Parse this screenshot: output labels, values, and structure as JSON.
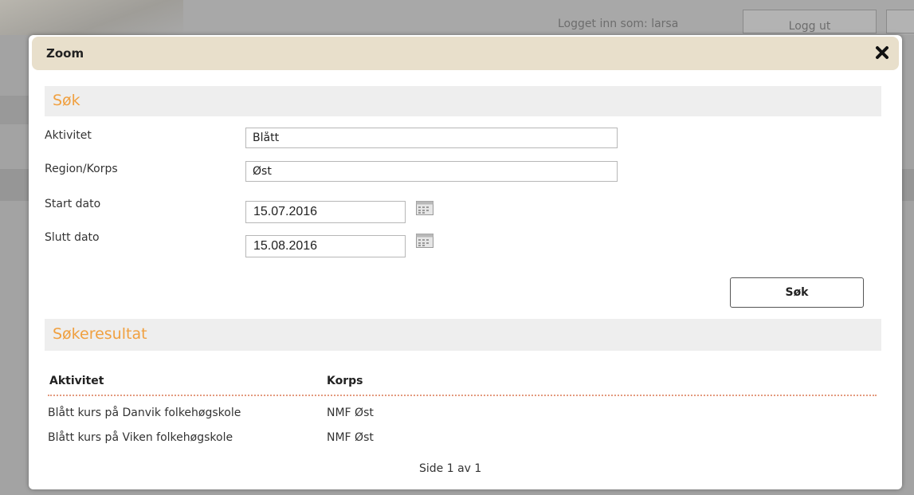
{
  "background": {
    "logged_in_text": "Logget inn som: larsa",
    "logout_label": "Logg ut"
  },
  "dialog": {
    "title": "Zoom",
    "close_icon": "close-x-icon"
  },
  "search": {
    "section_title": "Søk",
    "fields": {
      "activity_label": "Aktivitet",
      "activity_value": "Blått",
      "region_label": "Region/Korps",
      "region_value": "Øst",
      "start_label": "Start dato",
      "start_value": "15.07.2016",
      "end_label": "Slutt dato",
      "end_value": "15.08.2016"
    },
    "button_label": "Søk"
  },
  "results": {
    "section_title": "Søkeresultat",
    "columns": [
      "Aktivitet",
      "Korps"
    ],
    "rows": [
      [
        "Blått kurs på Danvik folkehøgskole",
        "NMF Øst"
      ],
      [
        "Blått kurs på Viken folkehøgskole",
        "NMF Øst"
      ]
    ],
    "pager": "Side 1 av 1"
  },
  "colors": {
    "section_title": "#f0a040",
    "title_bar": "#e8dfcb",
    "header_rule": "#e39a7e"
  }
}
